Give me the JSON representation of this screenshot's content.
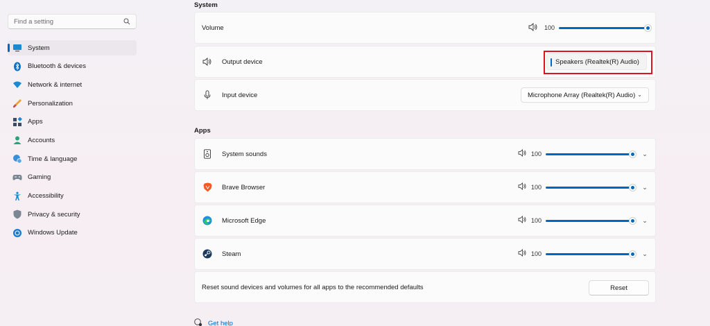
{
  "search": {
    "placeholder": "Find a setting",
    "icon": "search-icon"
  },
  "sidebar": {
    "items": [
      {
        "label": "System",
        "icon": "system-icon",
        "active": true
      },
      {
        "label": "Bluetooth & devices",
        "icon": "bluetooth-icon"
      },
      {
        "label": "Network & internet",
        "icon": "wifi-icon"
      },
      {
        "label": "Personalization",
        "icon": "brush-icon"
      },
      {
        "label": "Apps",
        "icon": "apps-icon"
      },
      {
        "label": "Accounts",
        "icon": "account-icon"
      },
      {
        "label": "Time & language",
        "icon": "globe-clock-icon"
      },
      {
        "label": "Gaming",
        "icon": "gamepad-icon"
      },
      {
        "label": "Accessibility",
        "icon": "accessibility-icon"
      },
      {
        "label": "Privacy & security",
        "icon": "shield-icon"
      },
      {
        "label": "Windows Update",
        "icon": "update-icon"
      }
    ]
  },
  "system_section": {
    "title": "System",
    "volume": {
      "label": "Volume",
      "value": "100"
    },
    "output": {
      "label": "Output device",
      "selected": "Speakers (Realtek(R) Audio)"
    },
    "input": {
      "label": "Input device",
      "selected": "Microphone Array (Realtek(R) Audio)"
    }
  },
  "apps_section": {
    "title": "Apps",
    "apps": [
      {
        "name": "System sounds",
        "icon": "speaker-box-icon",
        "volume": "100"
      },
      {
        "name": "Brave Browser",
        "icon": "brave-icon",
        "volume": "100"
      },
      {
        "name": "Microsoft Edge",
        "icon": "edge-icon",
        "volume": "100"
      },
      {
        "name": "Steam",
        "icon": "steam-icon",
        "volume": "100"
      }
    ],
    "reset": {
      "text": "Reset sound devices and volumes for all apps to the recommended defaults",
      "button": "Reset"
    }
  },
  "help": {
    "label": "Get help"
  },
  "colors": {
    "accent": "#0067c0",
    "highlight": "#e0121b"
  }
}
